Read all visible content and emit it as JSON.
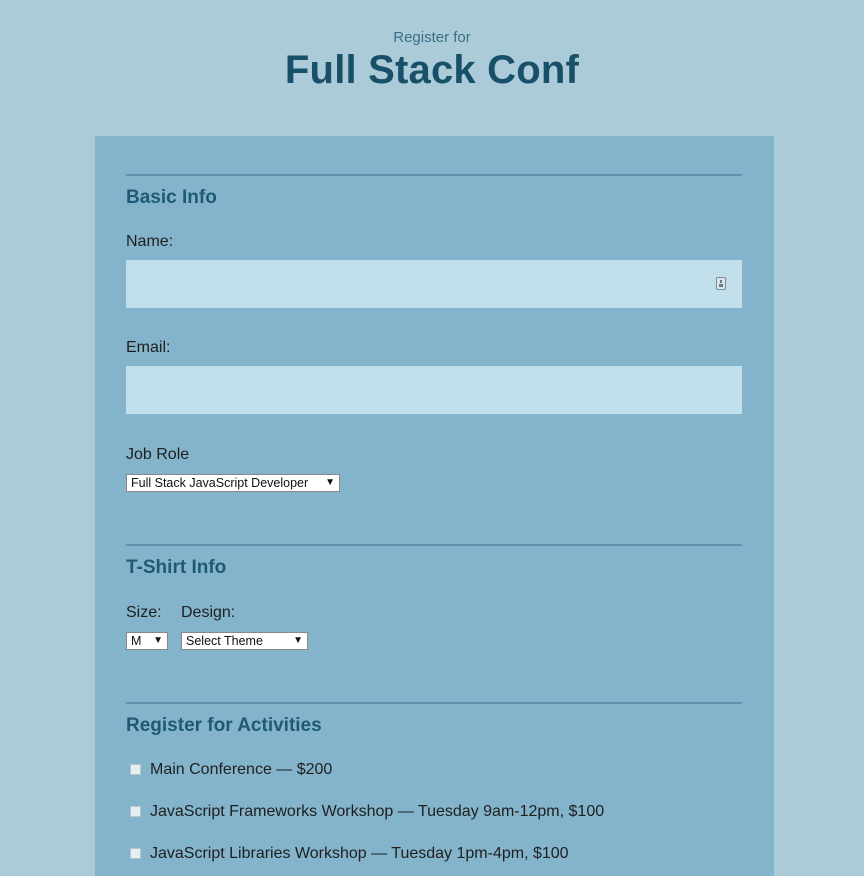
{
  "header": {
    "subtitle": "Register for",
    "title": "Full Stack Conf"
  },
  "basic_info": {
    "heading": "Basic Info",
    "name_label": "Name:",
    "name_value": "",
    "email_label": "Email:",
    "email_value": "",
    "job_role_label": "Job Role",
    "job_role_selected": "Full Stack JavaScript Developer"
  },
  "tshirt_info": {
    "heading": "T-Shirt Info",
    "size_label": "Size:",
    "size_selected": "M",
    "design_label": "Design:",
    "design_selected": "Select Theme"
  },
  "activities": {
    "heading": "Register for Activities",
    "items": [
      {
        "label": "Main Conference — $200",
        "checked": false
      },
      {
        "label": "JavaScript Frameworks Workshop — Tuesday 9am-12pm, $100",
        "checked": false
      },
      {
        "label": "JavaScript Libraries Workshop — Tuesday 1pm-4pm, $100",
        "checked": false
      }
    ]
  },
  "icons": {
    "select_arrow": "▼",
    "autofill": "contact-card-icon"
  },
  "colors": {
    "page_bg": "#abcbd9",
    "panel_bg": "#84b4cb",
    "input_bg": "#c1dfea",
    "heading": "#184f69"
  }
}
